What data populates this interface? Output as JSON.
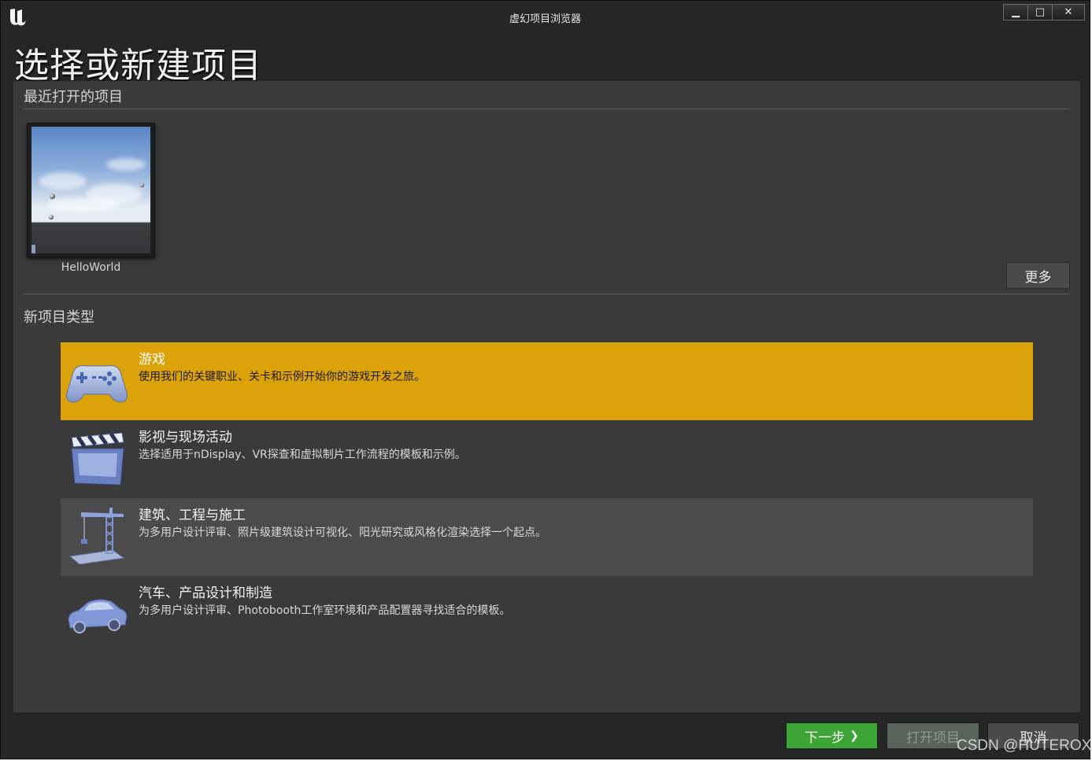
{
  "window": {
    "title": "虚幻项目浏览器",
    "controls": {
      "minimize": "▁",
      "maximize": "□",
      "close": "✕"
    }
  },
  "page": {
    "heading": "选择或新建项目"
  },
  "recent": {
    "section_title": "最近打开的项目",
    "projects": [
      {
        "name": "HelloWorld"
      }
    ],
    "more_label": "更多"
  },
  "new_types": {
    "section_title": "新项目类型",
    "items": [
      {
        "name": "游戏",
        "description": "使用我们的关键职业、关卡和示例开始你的游戏开发之旅。",
        "icon": "gamepad-icon",
        "selected": true
      },
      {
        "name": "影视与现场活动",
        "description": "选择适用于nDisplay、VR探查和虚拟制片工作流程的模板和示例。",
        "icon": "clapperboard-icon",
        "selected": false
      },
      {
        "name": "建筑、工程与施工",
        "description": "为多用户设计评审、照片级建筑设计可视化、阳光研究或风格化渲染选择一个起点。",
        "icon": "crane-icon",
        "selected": false
      },
      {
        "name": "汽车、产品设计和制造",
        "description": "为多用户设计评审、Photobooth工作室环境和产品配置器寻找适合的模板。",
        "icon": "car-icon",
        "selected": false
      }
    ]
  },
  "footer": {
    "next_label": "下一步",
    "next_chevron": "❯",
    "open_label": "打开项目",
    "cancel_label": "取消"
  },
  "watermark": "CSDN @HUTEROX",
  "colors": {
    "selected_row": "#dca20a",
    "next_button": "#3ca535",
    "panel": "#3a3a3a",
    "window_bg": "#262626"
  }
}
